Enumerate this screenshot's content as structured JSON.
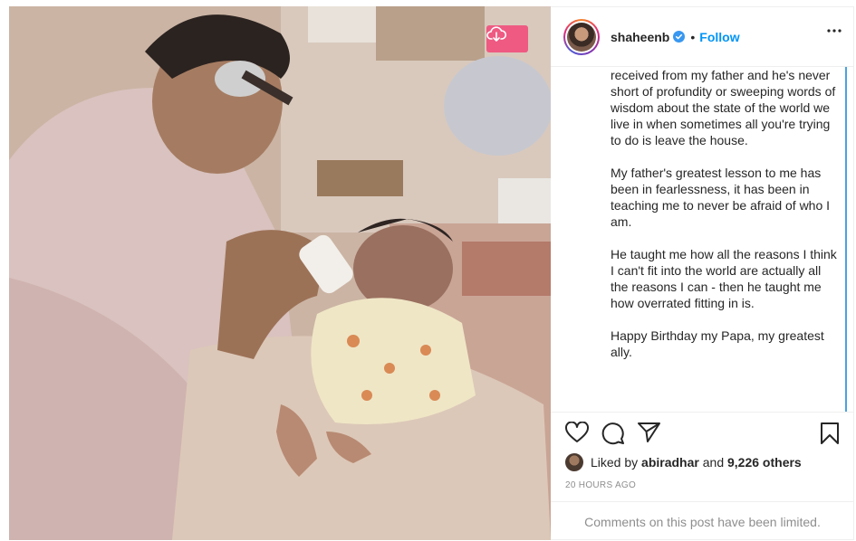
{
  "post": {
    "username": "shaheenb",
    "verified": true,
    "follow_label": "Follow",
    "separator": "•",
    "caption_paragraphs": [
      "received from my father and he's never short of profundity or sweeping words of wisdom about the state of the world we live in when sometimes all you're trying to do is leave the house.",
      "My father's greatest lesson to me has been in fearlessness, it has been in teaching me to never be afraid of who I am.",
      "He taught me how all the reasons I think I can't fit into the world are actually all the reasons I can - then he taught me how overrated fitting in is.",
      "Happy Birthday my Papa, my greatest ally."
    ],
    "likes": {
      "prefix": "Liked by",
      "first_user": "abiradhar",
      "middle": "and",
      "others": "9,226 others"
    },
    "timestamp": "20 HOURS AGO",
    "comments_notice": "Comments on this post have been limited."
  },
  "icons": {
    "download": "cloud-download-icon",
    "verified": "verified-badge-icon",
    "more": "more-options-icon",
    "like": "heart-icon",
    "comment": "comment-icon",
    "share": "paper-plane-icon",
    "save": "bookmark-icon"
  },
  "colors": {
    "follow_blue": "#0095f6",
    "download_pink": "#ee5a82",
    "muted_gray": "#8e8e8e",
    "scroll_blue": "#4aa3df"
  }
}
